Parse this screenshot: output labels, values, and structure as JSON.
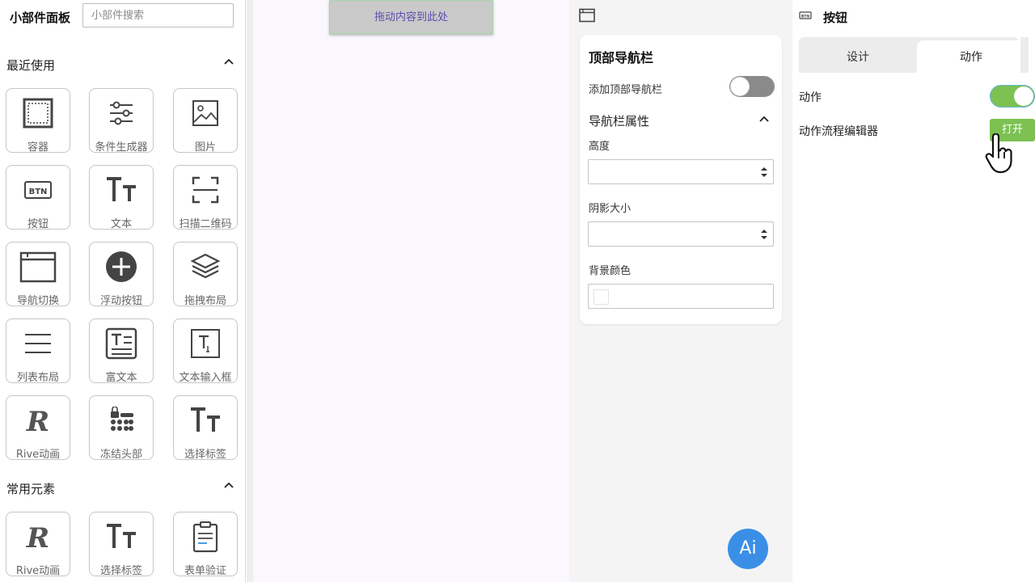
{
  "left_panel": {
    "title": "小部件面板",
    "search_placeholder": "小部件搜索",
    "recent_section": "最近使用",
    "recent_items": [
      {
        "label": "容器",
        "icon": "container-icon"
      },
      {
        "label": "条件生成器",
        "icon": "sliders-icon"
      },
      {
        "label": "图片",
        "icon": "image-icon"
      },
      {
        "label": "按钮",
        "icon": "btn-icon"
      },
      {
        "label": "文本",
        "icon": "text-icon"
      },
      {
        "label": "扫描二维码",
        "icon": "scan-icon"
      },
      {
        "label": "导航切换",
        "icon": "window-icon"
      },
      {
        "label": "浮动按钮",
        "icon": "plus-circle-icon"
      },
      {
        "label": "拖拽布局",
        "icon": "layers-icon"
      },
      {
        "label": "列表布局",
        "icon": "list-icon"
      },
      {
        "label": "富文本",
        "icon": "rich-text-icon"
      },
      {
        "label": "文本输入框",
        "icon": "text-input-icon"
      },
      {
        "label": "Rive动画",
        "icon": "rive-icon"
      },
      {
        "label": "冻结头部",
        "icon": "freeze-header-icon"
      },
      {
        "label": "选择标签",
        "icon": "text-icon"
      }
    ],
    "common_section": "常用元素",
    "common_items": [
      {
        "label": "Rive动画",
        "icon": "rive-icon"
      },
      {
        "label": "选择标签",
        "icon": "text-icon"
      },
      {
        "label": "表单验证",
        "icon": "clipboard-icon"
      }
    ]
  },
  "canvas": {
    "drop_hint": "拖动内容到此处"
  },
  "properties": {
    "card_title": "顶部导航栏",
    "add_nav_label": "添加顶部导航栏",
    "add_nav_enabled": false,
    "nav_props_label": "导航栏属性",
    "height_label": "高度",
    "height_value": "",
    "shadow_label": "阴影大小",
    "shadow_value": "",
    "bg_color_label": "背景颜色",
    "ai_button": "Ai"
  },
  "inspector": {
    "title": "按钮",
    "tabs": [
      {
        "label": "设计",
        "active": false
      },
      {
        "label": "动作",
        "active": true
      }
    ],
    "action_label": "动作",
    "action_enabled": true,
    "flow_editor_label": "动作流程编辑器",
    "open_button": "打开"
  },
  "colors": {
    "accent_green": "#7cc152",
    "ai_blue": "#3a8ee6",
    "drop_text": "#5b4fb0"
  }
}
